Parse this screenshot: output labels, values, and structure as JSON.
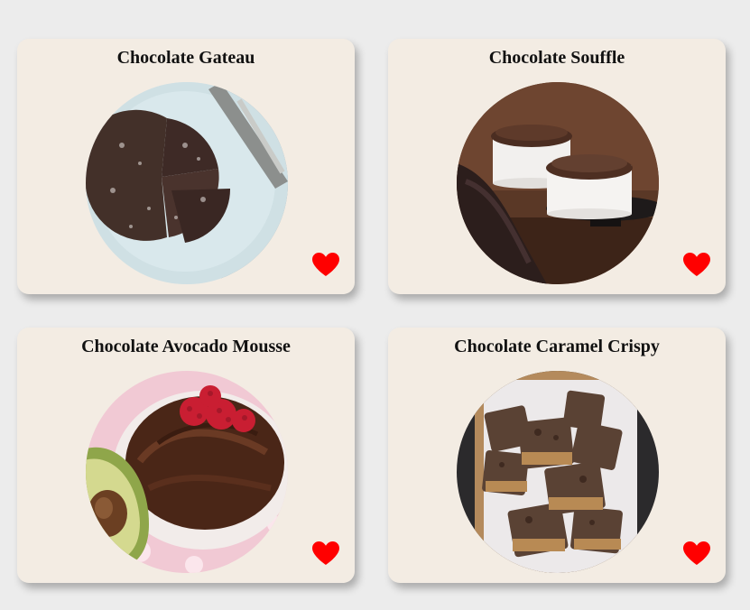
{
  "cards": [
    {
      "title": "Chocolate Gateau",
      "image": "chocolate-gateau-photo",
      "favorite_icon": "heart-icon",
      "favorite_color": "#ff0000"
    },
    {
      "title": "Chocolate Souffle",
      "image": "chocolate-souffle-photo",
      "favorite_icon": "heart-icon",
      "favorite_color": "#ff0000"
    },
    {
      "title": "Chocolate Avocado Mousse",
      "image": "chocolate-avocado-mousse-photo",
      "favorite_icon": "heart-icon",
      "favorite_color": "#ff0000"
    },
    {
      "title": "Chocolate Caramel Crispy",
      "image": "chocolate-caramel-crispy-photo",
      "favorite_icon": "heart-icon",
      "favorite_color": "#ff0000"
    }
  ],
  "colors": {
    "page_background": "#ececec",
    "card_background": "#f3ece3",
    "heart": "#ff0000"
  }
}
